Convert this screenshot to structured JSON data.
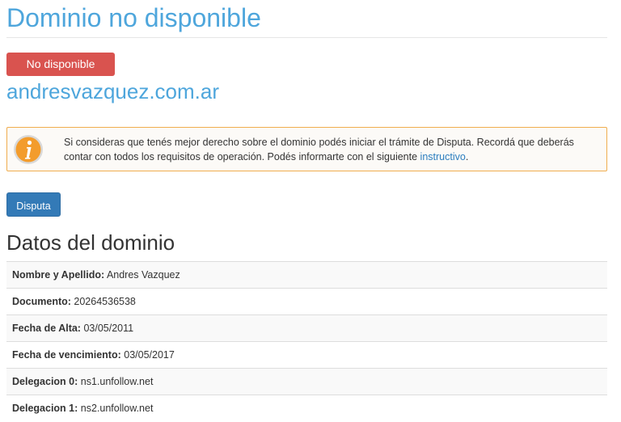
{
  "header": {
    "title": "Dominio no disponible"
  },
  "status": {
    "badge": "No disponible",
    "color": "#d9534f"
  },
  "domain": {
    "name": "andresvazquez.com.ar"
  },
  "alert": {
    "icon": "info-icon",
    "text_before": "Si consideras que tenés mejor derecho sobre el dominio podés iniciar el trámite de Disputa. Recordá que deberás contar con todos los requisitos de operación. Podés informarte con el siguiente ",
    "link": "instructivo",
    "text_after": "."
  },
  "actions": {
    "dispute_label": "Disputa"
  },
  "details": {
    "title": "Datos del dominio",
    "rows": [
      {
        "label": "Nombre y Apellido:",
        "value": "Andres Vazquez"
      },
      {
        "label": "Documento:",
        "value": "20264536538"
      },
      {
        "label": "Fecha de Alta:",
        "value": "03/05/2011"
      },
      {
        "label": "Fecha de vencimiento:",
        "value": "03/05/2017"
      },
      {
        "label": "Delegacion 0:",
        "value": "ns1.unfollow.net"
      },
      {
        "label": "Delegacion 1:",
        "value": "ns2.unfollow.net"
      }
    ]
  },
  "colors": {
    "accent": "#4ea6dc",
    "button": "#337ab7",
    "alert_border": "#f0ad4e",
    "icon": "#f39c2c"
  }
}
